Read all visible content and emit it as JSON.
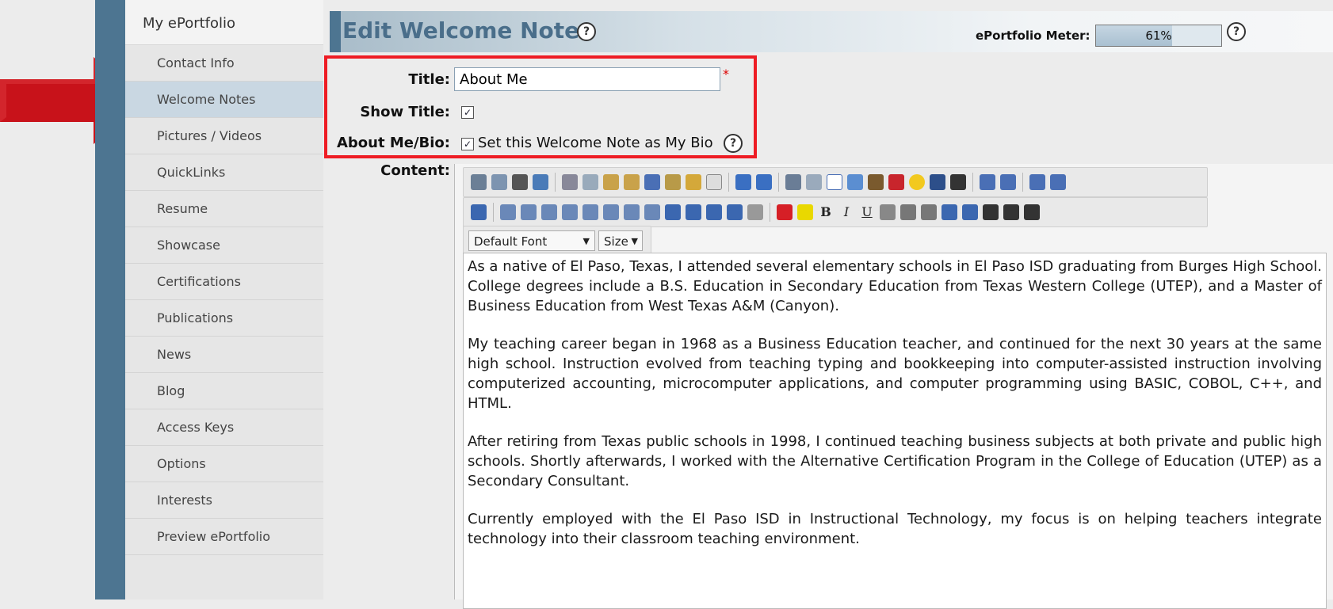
{
  "sidebar": {
    "header": "My ePortfolio",
    "items": [
      {
        "label": "Contact Info",
        "active": false
      },
      {
        "label": "Welcome Notes",
        "active": true
      },
      {
        "label": "Pictures / Videos",
        "active": false
      },
      {
        "label": "QuickLinks",
        "active": false
      },
      {
        "label": "Resume",
        "active": false
      },
      {
        "label": "Showcase",
        "active": false
      },
      {
        "label": "Certifications",
        "active": false
      },
      {
        "label": "Publications",
        "active": false
      },
      {
        "label": "News",
        "active": false
      },
      {
        "label": "Blog",
        "active": false
      },
      {
        "label": "Access Keys",
        "active": false
      },
      {
        "label": "Options",
        "active": false
      },
      {
        "label": "Interests",
        "active": false
      },
      {
        "label": "Preview ePortfolio",
        "active": false
      }
    ]
  },
  "header": {
    "title": "Edit Welcome Note",
    "meter_label": "ePortfolio Meter:",
    "meter_value": "61%",
    "meter_fraction": 0.61
  },
  "form": {
    "title_label": "Title:",
    "title_value": "About Me",
    "required_mark": "*",
    "show_title_label": "Show Title:",
    "show_title_checked": true,
    "bio_label": "About Me/Bio:",
    "bio_checked": true,
    "bio_text": "Set this Welcome Note as My Bio",
    "content_label": "Content:"
  },
  "editor": {
    "font_dropdown": "Default Font",
    "size_dropdown": "Size",
    "paragraphs": [
      "As a native of El Paso, Texas, I attended several elementary schools in El Paso ISD graduating from Burges High School.  College degrees include a B.S. Education in Secondary Education from Texas Western College (UTEP), and a Master of Business Education from West Texas A&M (Canyon).",
      "My teaching career began in 1968 as a Business Education teacher, and continued for the next 30 years at the same high school. Instruction evolved from teaching typing and bookkeeping into computer-assisted instruction involving computerized accounting, microcomputer applications, and computer programming using BASIC, COBOL, C++, and HTML.",
      "After retiring from Texas public schools in 1998, I continued teaching business subjects at both private and public high schools.  Shortly afterwards, I worked with the Alternative Certification Program in the College of Education (UTEP) as a Secondary Consultant.",
      "Currently employed with the El Paso ISD in Instructional Technology, my focus is on helping teachers integrate technology into their classroom teaching environment."
    ]
  },
  "colors": {
    "accent": "#4a6e8a",
    "stripe": "#4d7591",
    "highlight": "#ee1c24",
    "arrow": "#c8121a"
  }
}
